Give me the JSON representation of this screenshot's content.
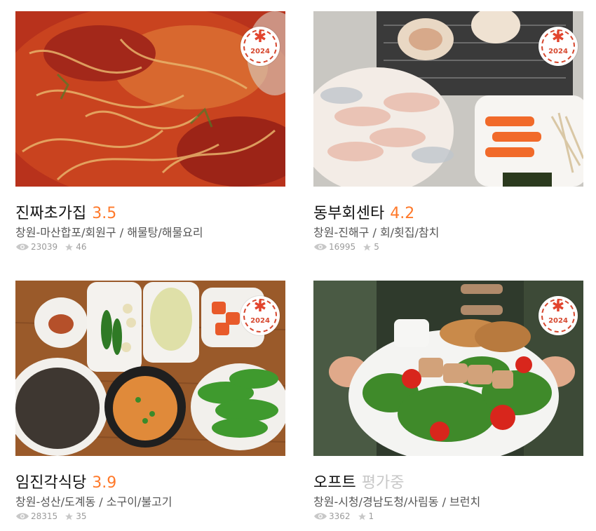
{
  "restaurants": [
    {
      "name": "진짜초가집",
      "rating": "3.5",
      "location": "창원-마산합포/회원구",
      "category": "해물탕/해물요리",
      "views": "23039",
      "reviews": "46",
      "badge_year": "2024",
      "badge_icon": "asterisk-badge-icon",
      "photo": "spicy-seafood-bean-sprouts",
      "rating_color": "#ff792a"
    },
    {
      "name": "동부회센타",
      "rating": "4.2",
      "location": "창원-진해구",
      "category": "회/횟집/참치",
      "views": "16995",
      "reviews": "5",
      "badge_year": "2024",
      "badge_icon": "asterisk-badge-icon",
      "photo": "sliced-raw-fish-and-grilled-scallops",
      "rating_color": "#ff792a"
    },
    {
      "name": "임진각식당",
      "rating": "3.9",
      "location": "창원-성산/도계동",
      "category": "소구이/불고기",
      "views": "28315",
      "reviews": "35",
      "badge_year": "2024",
      "badge_icon": "asterisk-badge-icon",
      "photo": "korean-table-with-side-dishes",
      "rating_color": "#ff792a"
    },
    {
      "name": "오프트",
      "rating": "평가중",
      "location": "창원-시청/경남도청/사림동",
      "category": "브런치",
      "views": "3362",
      "reviews": "1",
      "badge_year": "2024",
      "badge_icon": "asterisk-badge-icon",
      "photo": "salad-plate-held-by-person",
      "rating_color": "#c8c8c8"
    }
  ],
  "separator": " / ",
  "icons": {
    "views": "eye-icon",
    "reviews": "star-icon"
  },
  "colors": {
    "accent": "#ff792a",
    "badge": "#e2442d",
    "pending": "#c8c8c8",
    "meta": "#555555",
    "stats": "#9b9b9b"
  }
}
